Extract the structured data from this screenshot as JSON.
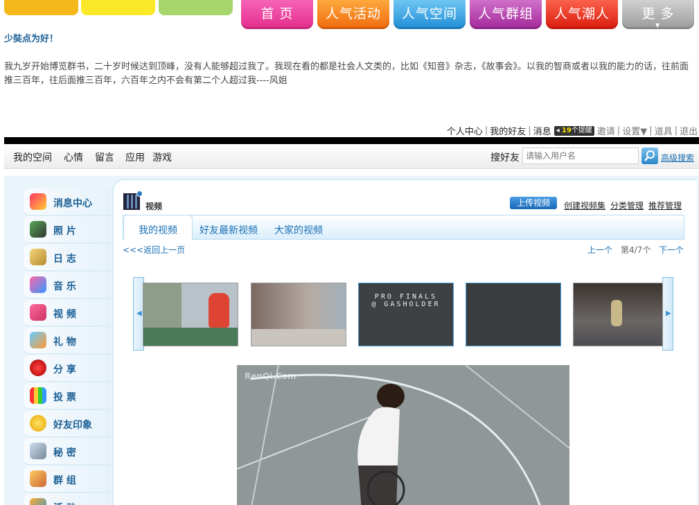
{
  "top_nav": {
    "tabs": [
      {
        "label": "首  页",
        "color": "#e32c8c"
      },
      {
        "label": "人气活动",
        "color": "#f06a0d"
      },
      {
        "label": "人气空间",
        "color": "#1f8ed6"
      },
      {
        "label": "人气群组",
        "color": "#a3279a"
      },
      {
        "label": "人气潮人",
        "color": "#db1a0d"
      },
      {
        "label": "更  多",
        "color": "#9b9b9b"
      }
    ]
  },
  "motto": {
    "title": "少奘点为好！",
    "body": "我九岁开始博览群书，二十岁时候达到顶峰，没有人能够超过我了。我现在看的都是社会人文类的，比如《知音》杂志，《故事会》。以我的智商或者以我的能力的话，往前面推三百年，往后面推三百年，六百年之内不会有第二个人超过我----风姐"
  },
  "user_links": {
    "personal_center": "个人中心",
    "my_friends": "我的好友",
    "messages": "消息",
    "reminder_count": "19",
    "reminder_suffix": "个提醒",
    "invite": "邀请",
    "settings": "设置▼",
    "props": "道具",
    "logout": "退出"
  },
  "sub_nav": {
    "items": [
      "我的空间",
      "心情",
      "留言",
      "应用",
      "游戏"
    ],
    "search_label": "搜好友",
    "search_placeholder": "请输入用户名",
    "advanced_search": "高级搜索"
  },
  "side_menu": {
    "items": [
      {
        "label": "消息中心",
        "icon": "message-center-icon"
      },
      {
        "label": "照    片",
        "icon": "camera-icon"
      },
      {
        "label": "日    志",
        "icon": "book-icon"
      },
      {
        "label": "音    乐",
        "icon": "music-icon"
      },
      {
        "label": "视    频",
        "icon": "tv-icon"
      },
      {
        "label": "礼    物",
        "icon": "gift-icon"
      },
      {
        "label": "分    享",
        "icon": "strawberry-icon"
      },
      {
        "label": "投    票",
        "icon": "vote-chart-icon"
      },
      {
        "label": "好友印象",
        "icon": "glasses-face-icon"
      },
      {
        "label": "秘    密",
        "icon": "bottle-icon"
      },
      {
        "label": "群    组",
        "icon": "house-icon"
      },
      {
        "label": "活    动",
        "icon": "activity-icon"
      }
    ]
  },
  "video_section": {
    "title": "视频",
    "upload_button": "上传视频",
    "links": [
      "创建视频集",
      "分类管理",
      "推荐管理"
    ],
    "tabs": [
      "我的视频",
      "好友最新视频",
      "大家的视频"
    ],
    "active_tab": "我的视频",
    "back_link": "<<<返回上一页",
    "prev": "上一个",
    "position": "第4/7个",
    "next": "下一个",
    "thumbnails": [
      {
        "caption": "",
        "kind": "news-anchor"
      },
      {
        "caption": "",
        "kind": "alley"
      },
      {
        "caption": "PRO FINALS\n@ GASHOLDER",
        "kind": "title-card"
      },
      {
        "caption": "",
        "kind": "dark-card"
      },
      {
        "caption": "",
        "kind": "bmx-rider"
      }
    ],
    "player_watermark": "RenQi.Com"
  }
}
